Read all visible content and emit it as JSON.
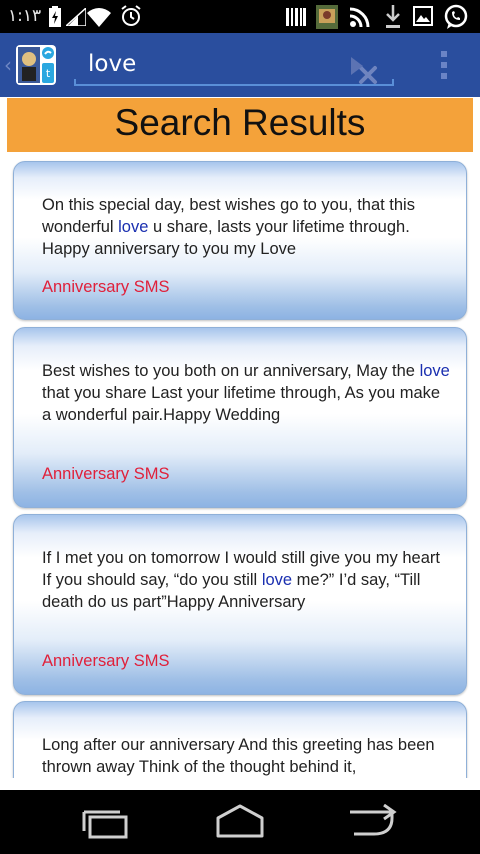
{
  "status_bar": {
    "time": "١:١٣",
    "icons": [
      "battery-charging-icon",
      "signal-icon",
      "wifi-icon",
      "alarm-icon",
      "barcode-icon",
      "app-thumbnail-icon",
      "rss-icon",
      "download-icon",
      "image-icon",
      "whatsapp-icon"
    ]
  },
  "action_bar": {
    "search_value": "love",
    "icons": [
      "back-caret-icon",
      "app-logo-icon",
      "clear-icon",
      "go-arrow-icon",
      "overflow-menu-icon"
    ]
  },
  "header": {
    "title": "Search Results"
  },
  "results": [
    {
      "before": "On this special day, best wishes go to you, that this wonderful ",
      "highlight": "love",
      "after": " u share, lasts your lifetime through. Happy anniversary to you my Love",
      "category": "Anniversary SMS"
    },
    {
      "before": "Best wishes to you both on ur anniversary, May the ",
      "highlight": "love",
      "after": " that you share Last your lifetime through, As you make a wonderful pair.Happy Wedding",
      "category": "Anniversary SMS"
    },
    {
      "before": "If I met you on tomorrow I would still give you my heart If you should say, “do you still ",
      "highlight": "love",
      "after": " me?” I’d say, “Till death do us part”Happy Anniversary",
      "category": "Anniversary SMS"
    },
    {
      "before": "Long after our anniversary And this greeting has been thrown away Think of the thought behind it,",
      "highlight": "",
      "after": "",
      "category": ""
    }
  ],
  "nav_bar": {
    "icons": [
      "recent-apps-icon",
      "home-icon",
      "back-icon"
    ]
  },
  "colors": {
    "action_bar": "#2a4e9e",
    "header": "#f4a23a",
    "highlight": "#1a2fb0",
    "category": "#e0203a"
  }
}
